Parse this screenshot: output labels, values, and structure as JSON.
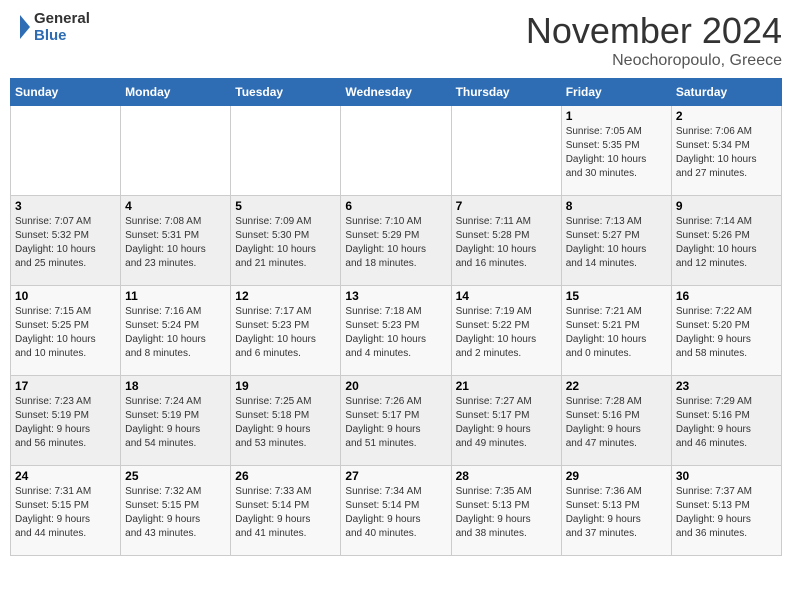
{
  "header": {
    "logo_line1": "General",
    "logo_line2": "Blue",
    "month": "November 2024",
    "location": "Neochoropoulo, Greece"
  },
  "weekdays": [
    "Sunday",
    "Monday",
    "Tuesday",
    "Wednesday",
    "Thursday",
    "Friday",
    "Saturday"
  ],
  "weeks": [
    [
      {
        "day": "",
        "info": ""
      },
      {
        "day": "",
        "info": ""
      },
      {
        "day": "",
        "info": ""
      },
      {
        "day": "",
        "info": ""
      },
      {
        "day": "",
        "info": ""
      },
      {
        "day": "1",
        "info": "Sunrise: 7:05 AM\nSunset: 5:35 PM\nDaylight: 10 hours\nand 30 minutes."
      },
      {
        "day": "2",
        "info": "Sunrise: 7:06 AM\nSunset: 5:34 PM\nDaylight: 10 hours\nand 27 minutes."
      }
    ],
    [
      {
        "day": "3",
        "info": "Sunrise: 7:07 AM\nSunset: 5:32 PM\nDaylight: 10 hours\nand 25 minutes."
      },
      {
        "day": "4",
        "info": "Sunrise: 7:08 AM\nSunset: 5:31 PM\nDaylight: 10 hours\nand 23 minutes."
      },
      {
        "day": "5",
        "info": "Sunrise: 7:09 AM\nSunset: 5:30 PM\nDaylight: 10 hours\nand 21 minutes."
      },
      {
        "day": "6",
        "info": "Sunrise: 7:10 AM\nSunset: 5:29 PM\nDaylight: 10 hours\nand 18 minutes."
      },
      {
        "day": "7",
        "info": "Sunrise: 7:11 AM\nSunset: 5:28 PM\nDaylight: 10 hours\nand 16 minutes."
      },
      {
        "day": "8",
        "info": "Sunrise: 7:13 AM\nSunset: 5:27 PM\nDaylight: 10 hours\nand 14 minutes."
      },
      {
        "day": "9",
        "info": "Sunrise: 7:14 AM\nSunset: 5:26 PM\nDaylight: 10 hours\nand 12 minutes."
      }
    ],
    [
      {
        "day": "10",
        "info": "Sunrise: 7:15 AM\nSunset: 5:25 PM\nDaylight: 10 hours\nand 10 minutes."
      },
      {
        "day": "11",
        "info": "Sunrise: 7:16 AM\nSunset: 5:24 PM\nDaylight: 10 hours\nand 8 minutes."
      },
      {
        "day": "12",
        "info": "Sunrise: 7:17 AM\nSunset: 5:23 PM\nDaylight: 10 hours\nand 6 minutes."
      },
      {
        "day": "13",
        "info": "Sunrise: 7:18 AM\nSunset: 5:23 PM\nDaylight: 10 hours\nand 4 minutes."
      },
      {
        "day": "14",
        "info": "Sunrise: 7:19 AM\nSunset: 5:22 PM\nDaylight: 10 hours\nand 2 minutes."
      },
      {
        "day": "15",
        "info": "Sunrise: 7:21 AM\nSunset: 5:21 PM\nDaylight: 10 hours\nand 0 minutes."
      },
      {
        "day": "16",
        "info": "Sunrise: 7:22 AM\nSunset: 5:20 PM\nDaylight: 9 hours\nand 58 minutes."
      }
    ],
    [
      {
        "day": "17",
        "info": "Sunrise: 7:23 AM\nSunset: 5:19 PM\nDaylight: 9 hours\nand 56 minutes."
      },
      {
        "day": "18",
        "info": "Sunrise: 7:24 AM\nSunset: 5:19 PM\nDaylight: 9 hours\nand 54 minutes."
      },
      {
        "day": "19",
        "info": "Sunrise: 7:25 AM\nSunset: 5:18 PM\nDaylight: 9 hours\nand 53 minutes."
      },
      {
        "day": "20",
        "info": "Sunrise: 7:26 AM\nSunset: 5:17 PM\nDaylight: 9 hours\nand 51 minutes."
      },
      {
        "day": "21",
        "info": "Sunrise: 7:27 AM\nSunset: 5:17 PM\nDaylight: 9 hours\nand 49 minutes."
      },
      {
        "day": "22",
        "info": "Sunrise: 7:28 AM\nSunset: 5:16 PM\nDaylight: 9 hours\nand 47 minutes."
      },
      {
        "day": "23",
        "info": "Sunrise: 7:29 AM\nSunset: 5:16 PM\nDaylight: 9 hours\nand 46 minutes."
      }
    ],
    [
      {
        "day": "24",
        "info": "Sunrise: 7:31 AM\nSunset: 5:15 PM\nDaylight: 9 hours\nand 44 minutes."
      },
      {
        "day": "25",
        "info": "Sunrise: 7:32 AM\nSunset: 5:15 PM\nDaylight: 9 hours\nand 43 minutes."
      },
      {
        "day": "26",
        "info": "Sunrise: 7:33 AM\nSunset: 5:14 PM\nDaylight: 9 hours\nand 41 minutes."
      },
      {
        "day": "27",
        "info": "Sunrise: 7:34 AM\nSunset: 5:14 PM\nDaylight: 9 hours\nand 40 minutes."
      },
      {
        "day": "28",
        "info": "Sunrise: 7:35 AM\nSunset: 5:13 PM\nDaylight: 9 hours\nand 38 minutes."
      },
      {
        "day": "29",
        "info": "Sunrise: 7:36 AM\nSunset: 5:13 PM\nDaylight: 9 hours\nand 37 minutes."
      },
      {
        "day": "30",
        "info": "Sunrise: 7:37 AM\nSunset: 5:13 PM\nDaylight: 9 hours\nand 36 minutes."
      }
    ]
  ]
}
